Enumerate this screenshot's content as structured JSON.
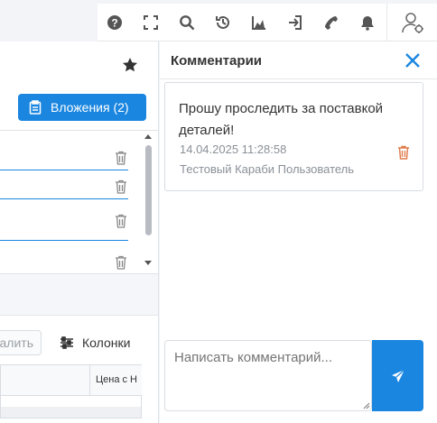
{
  "toolbar": {
    "icons": [
      "help-icon",
      "fullscreen-icon",
      "search-icon",
      "history-icon",
      "chart-icon",
      "login-icon",
      "phone-icon",
      "bell-icon",
      "user-settings-icon"
    ]
  },
  "left_panel": {
    "attachments_label": "Вложения (2)",
    "delete_label": "Удалить",
    "delete_visible_label": "далить",
    "columns_label": "Колонки",
    "table_header": "Цена с Н"
  },
  "comments": {
    "title": "Комментарии",
    "items": [
      {
        "text": "Прошу проследить за поставкой деталей!",
        "date": "14.04.2025 11:28:58",
        "author": "Тестовый Караби Пользователь"
      }
    ],
    "input_placeholder": "Написать комментарий..."
  },
  "colors": {
    "accent": "#1a86e0",
    "delete_icon": "#e07a4a",
    "muted_text": "#8a9097"
  }
}
